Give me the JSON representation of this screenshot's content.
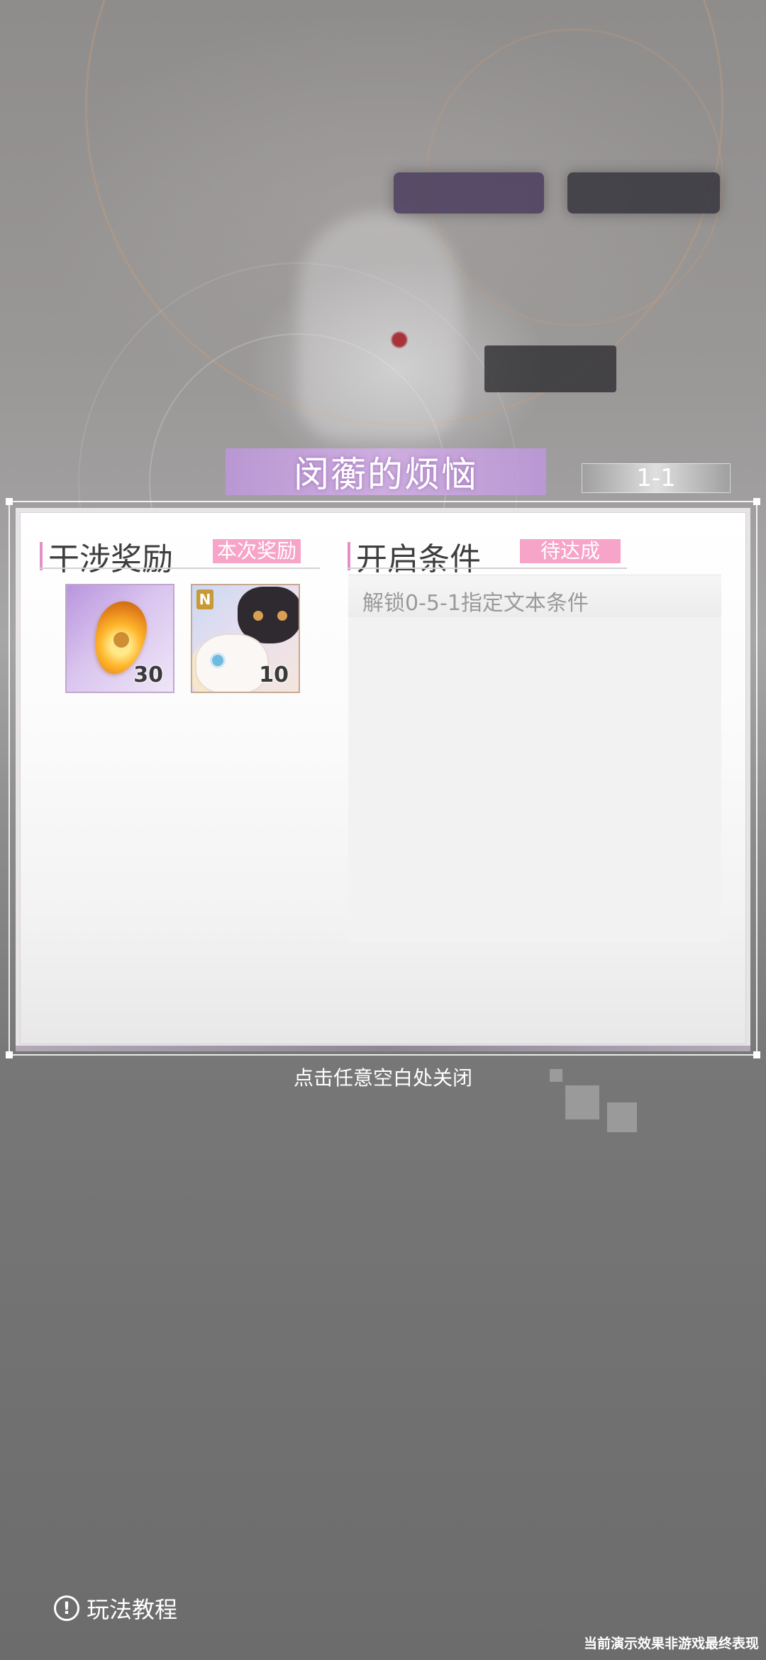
{
  "title": "闵蘅的烦恼",
  "stage_id": "1-1",
  "rewards_section": {
    "title": "干涉奖励",
    "badge": "本次奖励",
    "items": [
      {
        "name": "amber-crystal",
        "count": "30"
      },
      {
        "name": "cat-card",
        "count": "10",
        "rarity": "N"
      }
    ]
  },
  "conditions_section": {
    "title": "开启条件",
    "badge": "待达成",
    "conditions": [
      "解锁0-5-1指定文本条件"
    ]
  },
  "close_hint": "点击任意空白处关闭",
  "tutorial": {
    "icon": "exclamation-circle-icon",
    "glyph": "!",
    "label": "玩法教程"
  },
  "disclaimer": "当前演示效果非游戏最终表现",
  "colors": {
    "accent_pink": "#f7a4c9",
    "title_purple": "#c9a0e0",
    "panel_white": "#ffffff"
  }
}
